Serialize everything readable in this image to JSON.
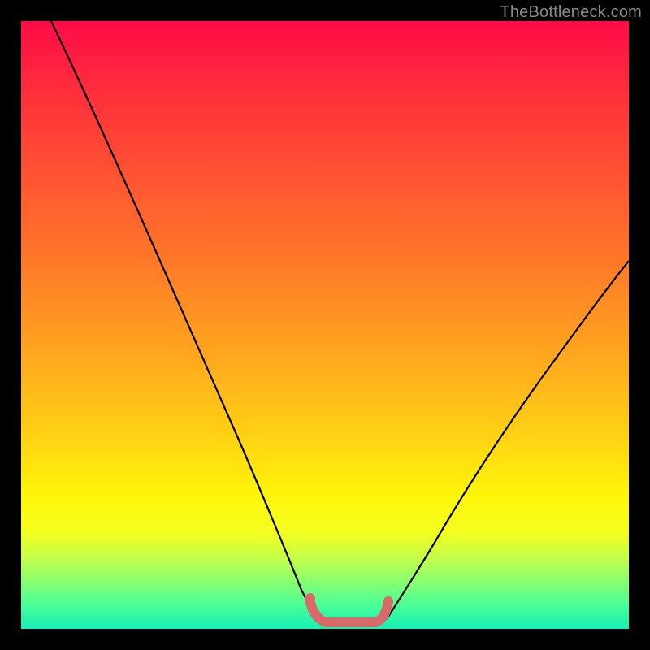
{
  "watermark": "TheBottleneck.com",
  "chart_data": {
    "type": "line",
    "title": "",
    "xlabel": "",
    "ylabel": "",
    "xlim": [
      0,
      100
    ],
    "ylim": [
      0,
      100
    ],
    "background_gradient": {
      "top_color": "#ff0b47",
      "bottom_color": "#14f0b4",
      "stops": [
        {
          "pos": 0.0,
          "color": "#ff0b47"
        },
        {
          "pos": 0.25,
          "color": "#ff5232"
        },
        {
          "pos": 0.55,
          "color": "#ffa71e"
        },
        {
          "pos": 0.78,
          "color": "#fff50a"
        },
        {
          "pos": 1.0,
          "color": "#14f0b4"
        }
      ]
    },
    "series": [
      {
        "name": "left-curve",
        "type": "line",
        "color": "#000000",
        "x": [
          5,
          10,
          15,
          20,
          25,
          30,
          35,
          40,
          44,
          47,
          49
        ],
        "y": [
          100,
          89,
          78,
          66,
          54,
          42,
          30,
          18,
          9,
          4,
          2
        ]
      },
      {
        "name": "right-curve",
        "type": "line",
        "color": "#000000",
        "x": [
          60,
          64,
          70,
          76,
          82,
          88,
          94,
          100
        ],
        "y": [
          2,
          5,
          12,
          20,
          29,
          38,
          47,
          56
        ]
      },
      {
        "name": "valley-band",
        "type": "line",
        "color": "#d86a6a",
        "stroke_width": 4,
        "x": [
          47,
          48,
          50,
          53,
          56,
          58,
          59,
          60
        ],
        "y": [
          4,
          1.5,
          0.8,
          0.6,
          0.6,
          0.8,
          1.5,
          4
        ]
      },
      {
        "name": "valley-dot",
        "type": "scatter",
        "color": "#d86a6a",
        "x": [
          47.5
        ],
        "y": [
          4.5
        ]
      }
    ]
  }
}
